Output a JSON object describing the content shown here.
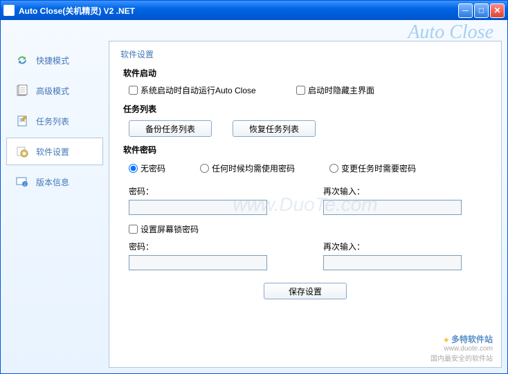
{
  "window": {
    "title": "Auto Close(关机精灵) V2 .NET"
  },
  "brand": "Auto Close",
  "sidebar": {
    "items": [
      {
        "label": "快捷模式"
      },
      {
        "label": "高级模式"
      },
      {
        "label": "任务列表"
      },
      {
        "label": "软件设置"
      },
      {
        "label": "版本信息"
      }
    ]
  },
  "panel": {
    "title": "软件设置",
    "section_startup": "软件启动",
    "chk_autorun": "系统启动时自动运行Auto Close",
    "chk_hide": "启动时隐藏主界面",
    "section_tasklist": "任务列表",
    "btn_backup": "备份任务列表",
    "btn_restore": "恢复任务列表",
    "section_password": "软件密码",
    "radio_none": "无密码",
    "radio_always": "任何时候均需使用密码",
    "radio_change": "变更任务时需要密码",
    "label_password": "密码：",
    "label_password_confirm": "再次输入：",
    "chk_screenlock": "设置屏幕锁密码",
    "btn_save": "保存设置"
  },
  "watermark": "www.DuoTe.com",
  "footer": {
    "line1": "多特软件站",
    "line2": "www.duote.com",
    "line3": "国内最安全的软件站"
  }
}
